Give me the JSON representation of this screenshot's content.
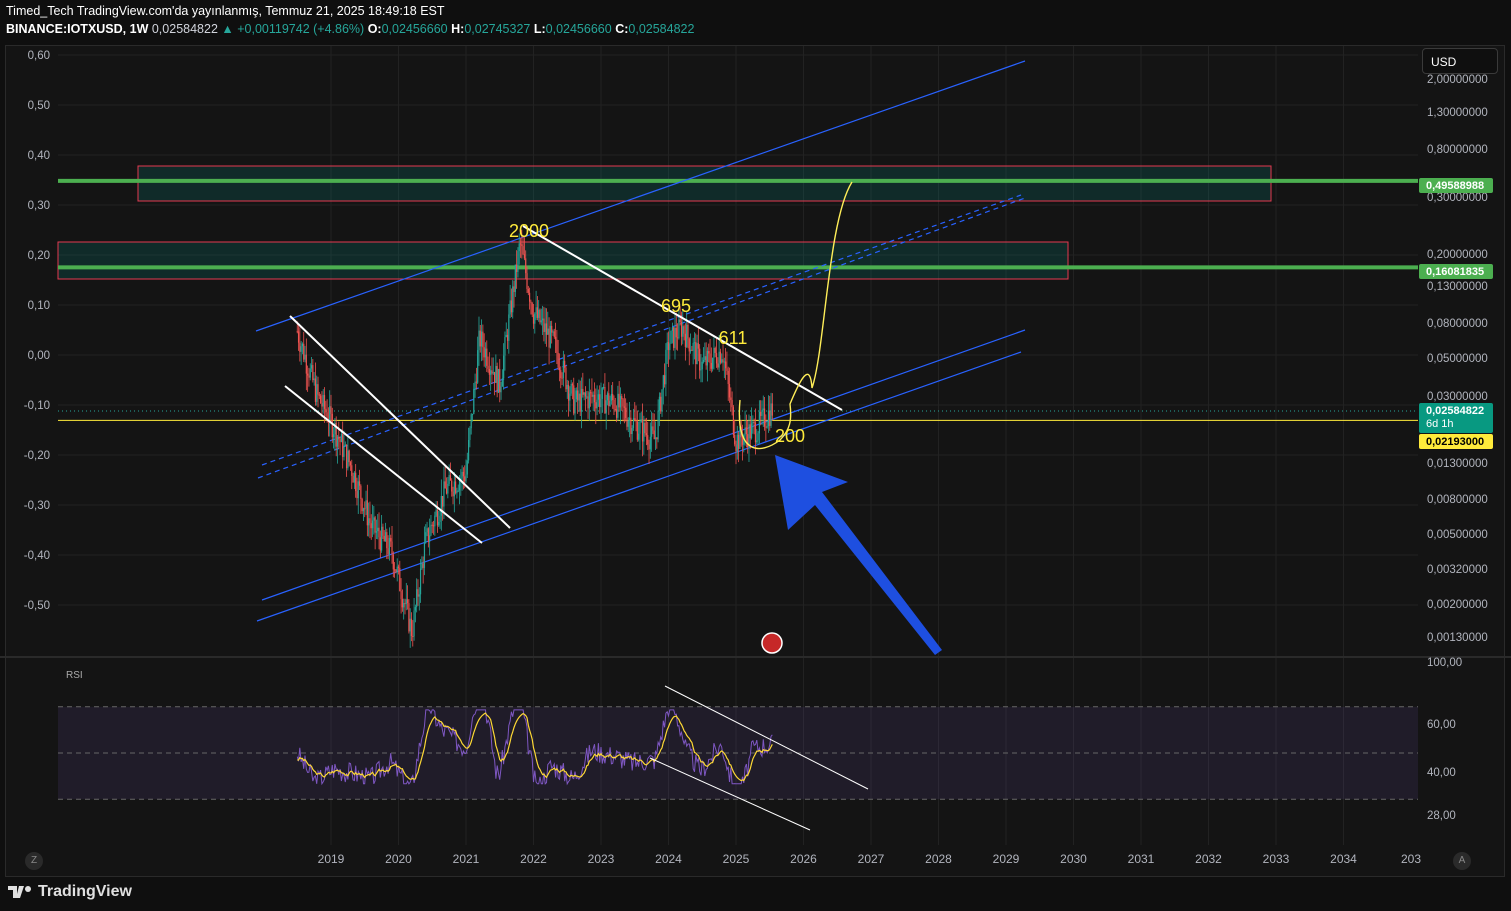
{
  "header": {
    "line1": "Timed_Tech TradingView.com'da yayınlanmış, Temmuz 21, 2025 18:49:18 EST",
    "symbol": "BINANCE:IOTXUSD, 1W",
    "last": "0,02584822",
    "change": "▲ +0,00119742 (+4.86%)",
    "o_label": "O:",
    "o": "0,02456660",
    "h_label": "H:",
    "h": "0,02745327",
    "l_label": "L:",
    "l": "0,02456660",
    "c_label": "C:",
    "c": "0,02584822"
  },
  "currency_button": "USD",
  "left_axis_ticks": [
    "0,60",
    "0,50",
    "0,40",
    "0,30",
    "0,20",
    "0,10",
    "0,00",
    "-0,10",
    "-0,20",
    "-0,30",
    "-0,40",
    "-0,50"
  ],
  "right_axis_ticks": [
    "2,00000000",
    "1,30000000",
    "0,80000000",
    "0,30000000",
    "0,20000000",
    "0,13000000",
    "0,08000000",
    "0,05000000",
    "0,03000000",
    "0,01300000",
    "0,00800000",
    "0,00500000",
    "0,00320000",
    "0,00200000",
    "0,00130000"
  ],
  "price_labels": {
    "upper_level": "0,49588988",
    "lower_level": "0,16081835",
    "current": "0,02584822",
    "countdown": "6d 1h",
    "yellow_line": "0,02193000"
  },
  "annotations": [
    "2000",
    "695",
    "611",
    "200"
  ],
  "rsi": {
    "label": "RSI",
    "ticks": [
      "100,00",
      "60,00",
      "40,00",
      "28,00"
    ]
  },
  "x_axis_ticks": [
    "2019",
    "2020",
    "2021",
    "2022",
    "2023",
    "2024",
    "2025",
    "2026",
    "2027",
    "2028",
    "2029",
    "2030",
    "2031",
    "2032",
    "2033",
    "2034",
    "203"
  ],
  "corner_buttons": {
    "left": "Z",
    "right": "A"
  },
  "footer_brand": "TradingView",
  "colors": {
    "background": "#141414",
    "up_candle": "#26a69a",
    "down_candle": "#ef5350",
    "channel": "#2962ff",
    "support_green": "#4caf50",
    "zone_border": "#e53950",
    "annotation_yellow": "#ffeb3b",
    "rsi_line": "#7e57c2",
    "arrow_blue": "#1e4fe0"
  },
  "chart_data": {
    "type": "candlestick",
    "title": "",
    "series": [
      {
        "name": "IOTXUSD",
        "x": [
          2018.5,
          2018.8,
          2019.0,
          2019.3,
          2019.6,
          2019.9,
          2020.2,
          2020.4,
          2020.7,
          2021.0,
          2021.2,
          2021.5,
          2021.8,
          2022.0,
          2022.3,
          2022.6,
          2022.9,
          2023.2,
          2023.5,
          2023.8,
          2024.0,
          2024.2,
          2024.5,
          2024.8,
          2025.0,
          2025.3,
          2025.55
        ],
        "values": [
          0.07,
          0.03,
          0.022,
          0.012,
          0.0055,
          0.004,
          0.0014,
          0.0045,
          0.009,
          0.011,
          0.065,
          0.035,
          0.22,
          0.09,
          0.06,
          0.028,
          0.03,
          0.028,
          0.021,
          0.017,
          0.06,
          0.075,
          0.045,
          0.055,
          0.017,
          0.02,
          0.0258
        ]
      }
    ],
    "levels": [
      0.49588988,
      0.16081835,
      0.02193
    ],
    "ylim": [
      0.0011,
      2.2
    ],
    "xlim": [
      2018.0,
      2034.9
    ],
    "yscale": "log"
  }
}
